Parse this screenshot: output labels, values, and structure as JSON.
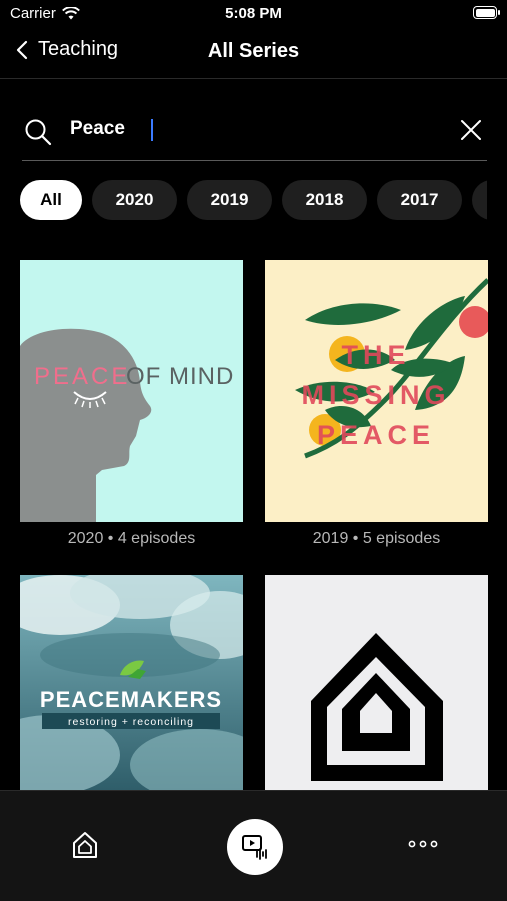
{
  "status_bar": {
    "carrier": "Carrier",
    "time": "5:08 PM"
  },
  "nav": {
    "back_label": "Teaching",
    "title": "All Series"
  },
  "search": {
    "value": "Peace",
    "placeholder": ""
  },
  "filters": [
    "All",
    "2020",
    "2019",
    "2018",
    "2017",
    "2"
  ],
  "series": [
    {
      "art_title_a": "PEACE",
      "art_title_b": "OF MIND",
      "meta": "2020 • 4 episodes"
    },
    {
      "art_lines": [
        "THE",
        "MISSING",
        "PEACE"
      ],
      "meta": "2019 • 5 episodes"
    },
    {
      "art_title": "PEACEMAKERS",
      "art_subtitle": "restoring + reconciling"
    },
    {
      "art_icon": "house-icon"
    }
  ],
  "colors": {
    "accent_caret": "#3b7bff",
    "mind_bg": "#c3f7ef",
    "mind_head": "#8b8f8e",
    "mind_pink": "#f06e8c",
    "missing_bg": "#fcefc6",
    "missing_text": "#e0485a",
    "leaf_green": "#1f6b3c"
  },
  "tabbar": {
    "home": "home-icon",
    "media": "media-player-icon",
    "more": "more-icon"
  }
}
